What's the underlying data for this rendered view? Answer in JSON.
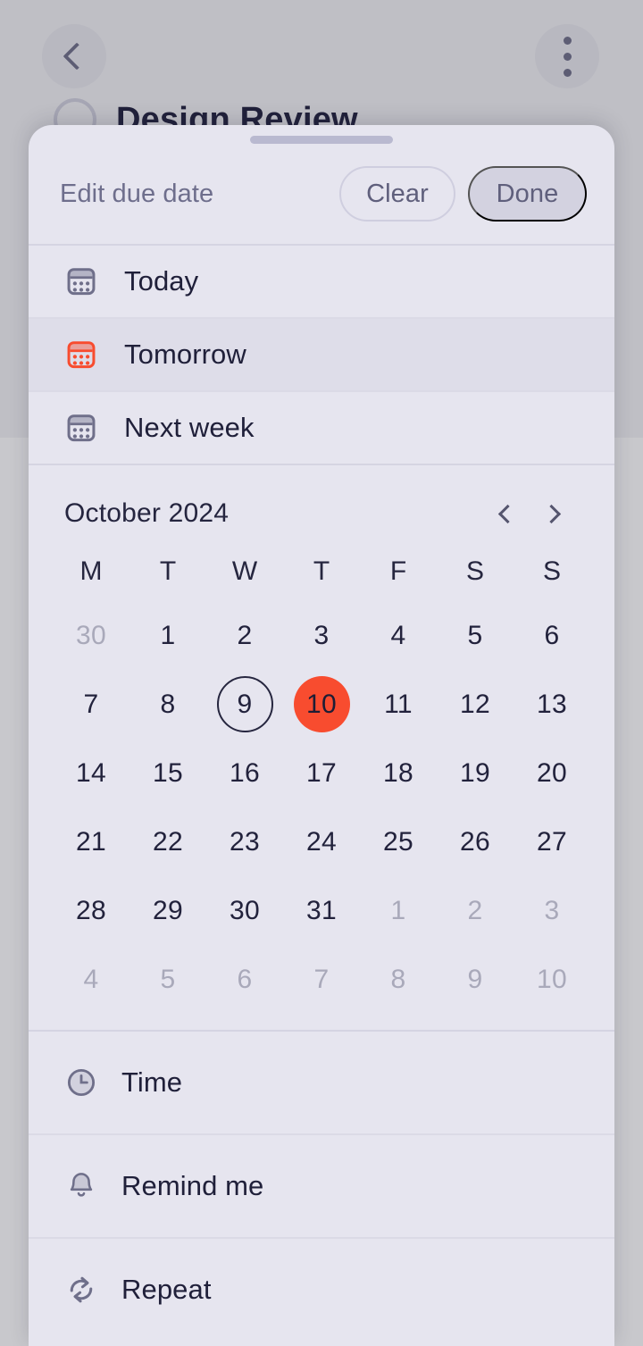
{
  "background_app": {
    "back_button": "back-chevron-icon",
    "overflow_menu": "three-dot-menu-icon",
    "task_title": "Design Review"
  },
  "sheet": {
    "drag_handle": "drag-handle",
    "title": "Edit due date",
    "clear_label": "Clear",
    "done_label": "Done",
    "quick_options": [
      {
        "label": "Today",
        "icon": "calendar-icon",
        "selected": false
      },
      {
        "label": "Tomorrow",
        "icon": "calendar-icon",
        "selected": true
      },
      {
        "label": "Next week",
        "icon": "calendar-icon",
        "selected": false
      }
    ],
    "calendar": {
      "month_label": "October 2024",
      "prev_label": "prev-month",
      "next_label": "next-month",
      "weekdays": [
        "M",
        "T",
        "W",
        "T",
        "F",
        "S",
        "S"
      ],
      "weeks": [
        [
          {
            "d": "30",
            "muted": true
          },
          {
            "d": "1"
          },
          {
            "d": "2"
          },
          {
            "d": "3"
          },
          {
            "d": "4"
          },
          {
            "d": "5"
          },
          {
            "d": "6"
          }
        ],
        [
          {
            "d": "7"
          },
          {
            "d": "8"
          },
          {
            "d": "9",
            "today": true
          },
          {
            "d": "10",
            "selected": true
          },
          {
            "d": "11"
          },
          {
            "d": "12"
          },
          {
            "d": "13"
          }
        ],
        [
          {
            "d": "14"
          },
          {
            "d": "15"
          },
          {
            "d": "16"
          },
          {
            "d": "17"
          },
          {
            "d": "18"
          },
          {
            "d": "19"
          },
          {
            "d": "20"
          }
        ],
        [
          {
            "d": "21"
          },
          {
            "d": "22"
          },
          {
            "d": "23"
          },
          {
            "d": "24"
          },
          {
            "d": "25"
          },
          {
            "d": "26"
          },
          {
            "d": "27"
          }
        ],
        [
          {
            "d": "28"
          },
          {
            "d": "29"
          },
          {
            "d": "30"
          },
          {
            "d": "31"
          },
          {
            "d": "1",
            "muted": true
          },
          {
            "d": "2",
            "muted": true
          },
          {
            "d": "3",
            "muted": true
          }
        ],
        [
          {
            "d": "4",
            "muted": true
          },
          {
            "d": "5",
            "muted": true
          },
          {
            "d": "6",
            "muted": true
          },
          {
            "d": "7",
            "muted": true
          },
          {
            "d": "8",
            "muted": true
          },
          {
            "d": "9",
            "muted": true
          },
          {
            "d": "10",
            "muted": true
          }
        ]
      ]
    },
    "options": [
      {
        "label": "Time",
        "icon": "clock-icon"
      },
      {
        "label": "Remind me",
        "icon": "bell-icon"
      },
      {
        "label": "Repeat",
        "icon": "repeat-icon"
      }
    ]
  },
  "colors": {
    "accent": "#f84c2f",
    "sheet_bg": "#e6e5ef",
    "selected_row_bg": "#dedde9",
    "text_primary": "#20203a",
    "text_muted": "#6e6e8c",
    "day_muted": "#a9a9ba",
    "icon_gray": "#6f6f8a",
    "scrim": "#bfbfc5"
  }
}
